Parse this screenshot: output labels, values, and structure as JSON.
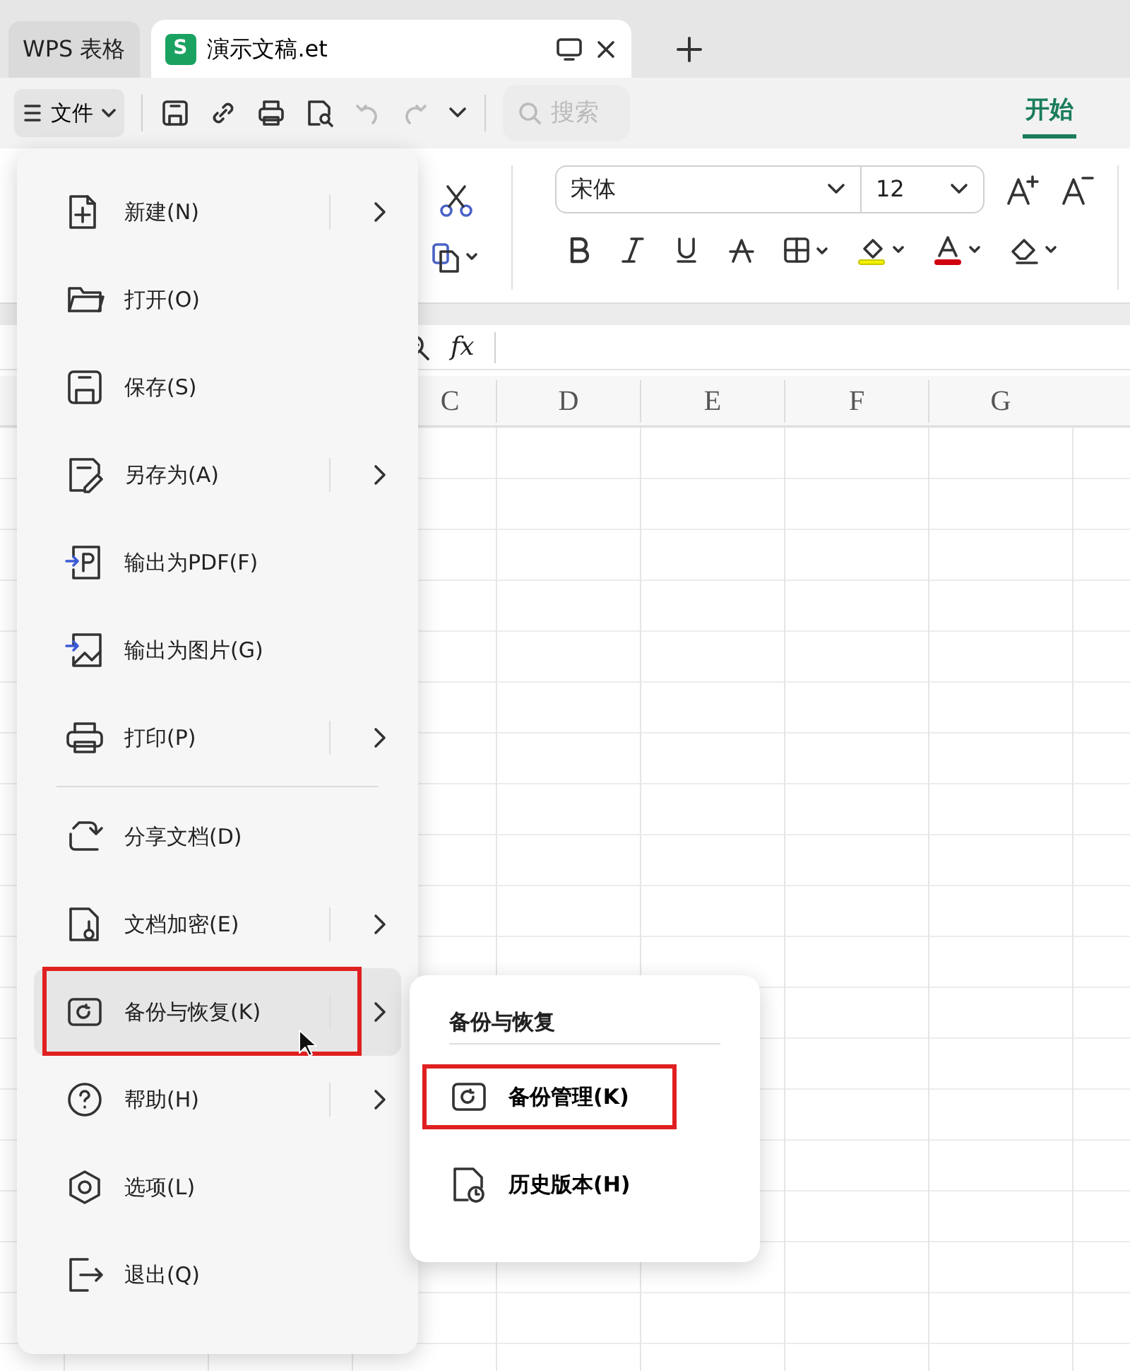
{
  "app_tabs": [
    {
      "label": "WPS 表格",
      "kind": "home",
      "selected": false
    },
    {
      "label": "演示文稿.et",
      "kind": "document",
      "selected": true,
      "badge": "S"
    }
  ],
  "toolbar": {
    "file_button": "文件",
    "search_placeholder": "搜索",
    "ribbon_tabs": [
      {
        "label": "开始",
        "selected": true
      }
    ]
  },
  "ribbon": {
    "font_name": "宋体",
    "font_size": "12"
  },
  "formula_bar": {
    "function_label": "fx"
  },
  "sheet": {
    "columns": [
      "C",
      "D",
      "E",
      "F",
      "G"
    ]
  },
  "file_menu": {
    "items": [
      {
        "kind": "item",
        "label": "新建(N)",
        "submenu": true,
        "selected": false,
        "annotated": false
      },
      {
        "kind": "item",
        "label": "打开(O)",
        "submenu": false,
        "selected": false,
        "annotated": false
      },
      {
        "kind": "item",
        "label": "保存(S)",
        "submenu": false,
        "selected": false,
        "annotated": false
      },
      {
        "kind": "item",
        "label": "另存为(A)",
        "submenu": true,
        "selected": false,
        "annotated": false
      },
      {
        "kind": "item",
        "label": "输出为PDF(F)",
        "submenu": false,
        "selected": false,
        "annotated": false
      },
      {
        "kind": "item",
        "label": "输出为图片(G)",
        "submenu": false,
        "selected": false,
        "annotated": false
      },
      {
        "kind": "item",
        "label": "打印(P)",
        "submenu": true,
        "selected": false,
        "annotated": false
      },
      {
        "kind": "divider"
      },
      {
        "kind": "item",
        "label": "分享文档(D)",
        "submenu": false,
        "selected": false,
        "annotated": false
      },
      {
        "kind": "item",
        "label": "文档加密(E)",
        "submenu": true,
        "selected": false,
        "annotated": false
      },
      {
        "kind": "item",
        "label": "备份与恢复(K)",
        "submenu": true,
        "selected": true,
        "annotated": true
      },
      {
        "kind": "item",
        "label": "帮助(H)",
        "submenu": true,
        "selected": false,
        "annotated": false
      },
      {
        "kind": "item",
        "label": "选项(L)",
        "submenu": false,
        "selected": false,
        "annotated": false
      },
      {
        "kind": "item",
        "label": "退出(Q)",
        "submenu": false,
        "selected": false,
        "annotated": false
      }
    ]
  },
  "submenu": {
    "title": "备份与恢复",
    "items": [
      {
        "label": "备份管理(K)",
        "annotated": true
      },
      {
        "label": "历史版本(H)",
        "annotated": false
      }
    ]
  }
}
